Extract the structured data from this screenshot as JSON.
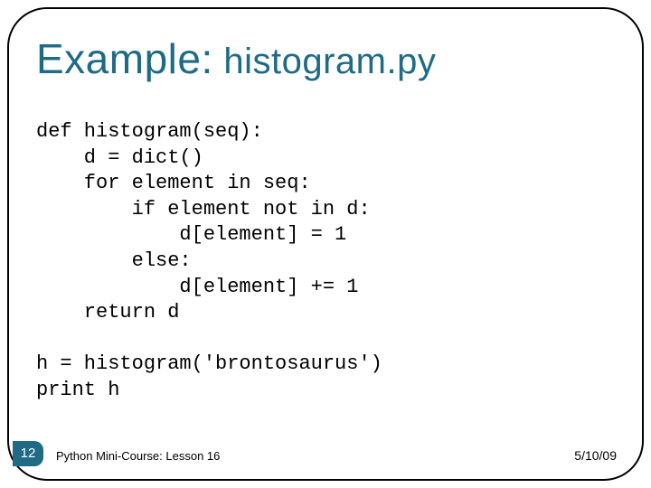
{
  "title": {
    "prefix": "Example:",
    "filename": "histogram.py"
  },
  "code": "def histogram(seq):\n    d = dict()\n    for element in seq:\n        if element not in d:\n            d[element] = 1\n        else:\n            d[element] += 1\n    return d\n\nh = histogram('brontosaurus')\nprint h",
  "footer": {
    "page": "12",
    "course": "Python Mini-Course: Lesson 16",
    "date": "5/10/09"
  }
}
